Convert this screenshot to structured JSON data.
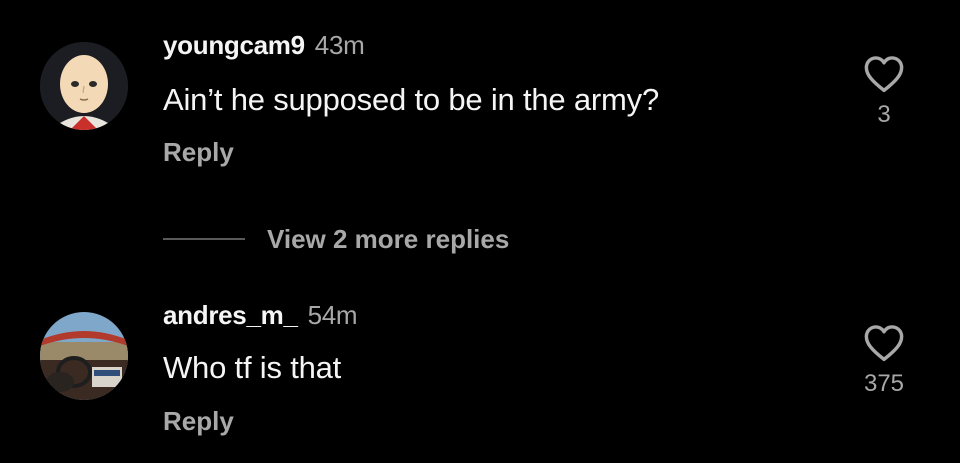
{
  "comments": [
    {
      "username": "youngcam9",
      "time": "43m",
      "text": "Ain’t he supposed to be in the army?",
      "reply_label": "Reply",
      "likes": "3",
      "avatar_icon": "bald-cartoon-avatar-icon"
    },
    {
      "username": "andres_m_",
      "time": "54m",
      "text": "Who tf is that",
      "reply_label": "Reply",
      "likes": "375",
      "avatar_icon": "car-driver-photo-avatar"
    }
  ],
  "view_more": {
    "label": "View 2 more replies"
  },
  "colors": {
    "background": "#000000",
    "primary_text": "#f5f5f5",
    "secondary_text": "#a8a8a8"
  }
}
